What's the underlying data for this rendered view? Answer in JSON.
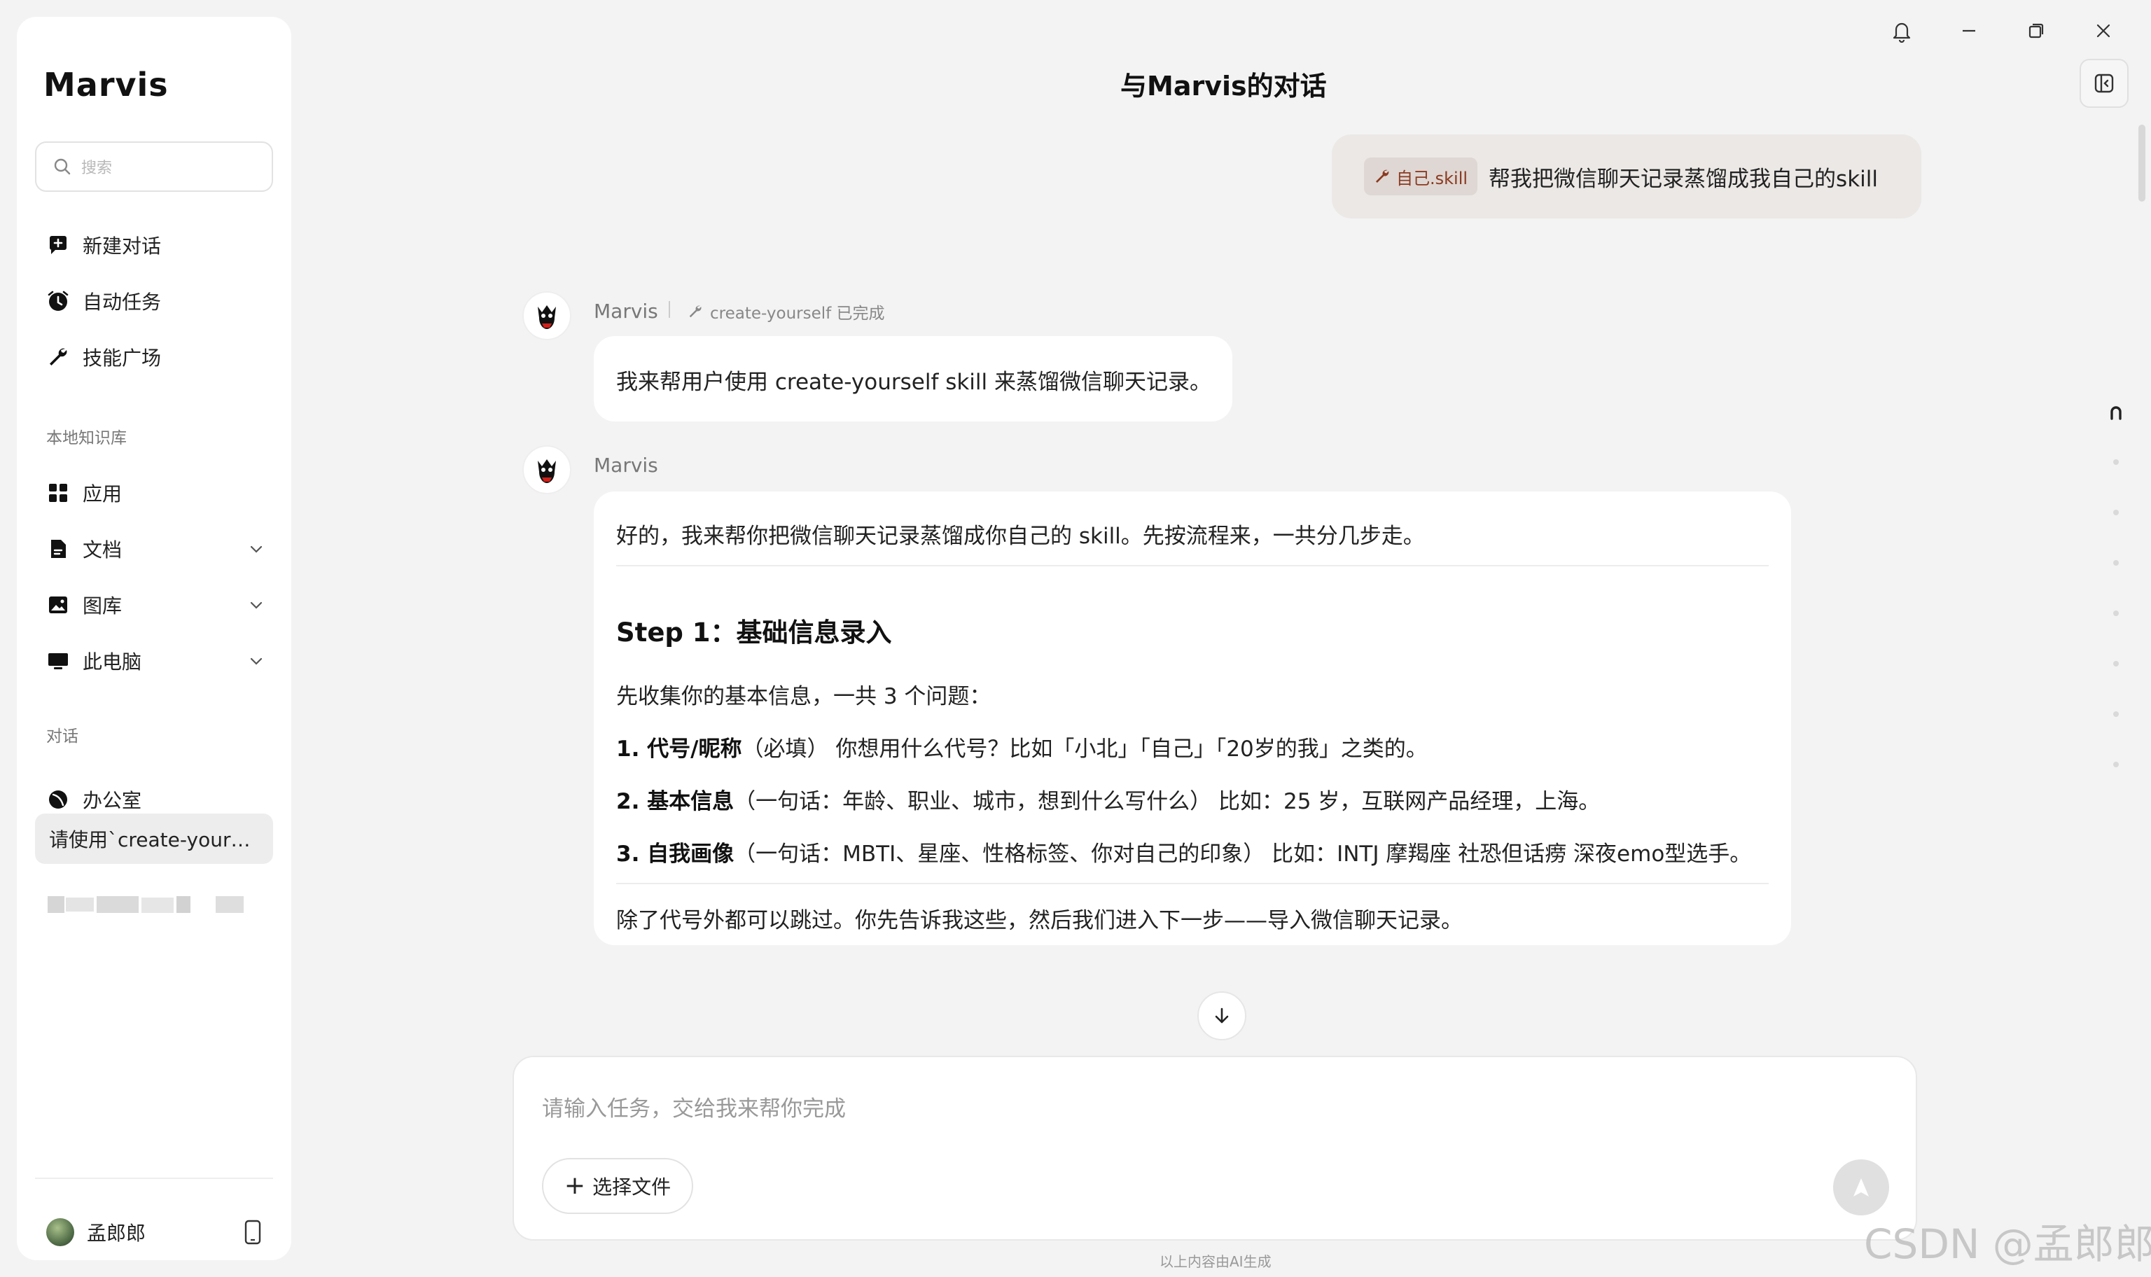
{
  "app": {
    "logo": "Marvis",
    "title": "与Marvis的对话"
  },
  "sidebar": {
    "search_placeholder": "搜索",
    "nav": [
      {
        "label": "新建对话",
        "icon": "new-chat-icon"
      },
      {
        "label": "自动任务",
        "icon": "clock-icon"
      },
      {
        "label": "技能广场",
        "icon": "wrench-icon"
      }
    ],
    "kb_section": "本地知识库",
    "kb_items": [
      {
        "label": "应用",
        "icon": "apps-grid-icon"
      },
      {
        "label": "文档",
        "icon": "document-icon"
      },
      {
        "label": "图库",
        "icon": "image-icon"
      },
      {
        "label": "此电脑",
        "icon": "monitor-icon"
      }
    ],
    "conv_section": "对话",
    "conversations": [
      {
        "label": "办公室",
        "icon": "leaf-icon"
      },
      {
        "label": "请使用`create-yourself`帮我把微信聊天记录蒸馏成我自己的skill"
      }
    ],
    "user_name": "孟郎郎"
  },
  "messages": {
    "user": {
      "skill_tag": "自己.skill",
      "text": "帮我把微信聊天记录蒸馏成我自己的skill"
    },
    "bot1": {
      "name": "Marvis",
      "status": "create-yourself 已完成",
      "text": "我来帮用户使用 create-yourself skill 来蒸馏微信聊天记录。"
    },
    "bot2": {
      "name": "Marvis",
      "intro": "好的，我来帮你把微信聊天记录蒸馏成你自己的 skill。先按流程来，一共分几步走。",
      "heading": "Step 1：基础信息录入",
      "lead": "先收集你的基本信息，一共 3 个问题：",
      "items": [
        {
          "num": "1. ",
          "key": "代号/昵称",
          "rest": "（必填） 你想用什么代号？比如「小北」「自己」「20岁的我」之类的。"
        },
        {
          "num": "2. ",
          "key": "基本信息",
          "rest": "（一句话：年龄、职业、城市，想到什么写什么） 比如：25 岁，互联网产品经理，上海。"
        },
        {
          "num": "3. ",
          "key": "自我画像",
          "rest": "（一句话：MBTI、星座、性格标签、你对自己的印象） 比如：INTJ 摩羯座 社恐但话痨 深夜emo型选手。"
        }
      ],
      "outro": "除了代号外都可以跳过。你先告诉我这些，然后我们进入下一步——导入微信聊天记录。"
    }
  },
  "composer": {
    "placeholder": "请输入任务，交给我来帮你完成",
    "file_button": "选择文件"
  },
  "footer_note": "以上内容由AI生成",
  "watermark": "CSDN @孟郎郎",
  "colors": {
    "accent": "#8a3a20",
    "background": "#f3f3f3",
    "card": "#ffffff"
  }
}
